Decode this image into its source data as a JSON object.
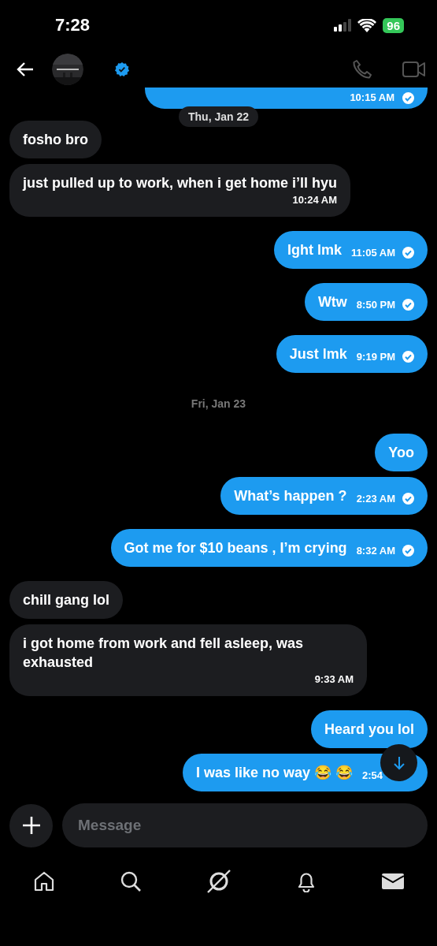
{
  "status_bar": {
    "time": "7:28",
    "battery": "96"
  },
  "header": {
    "verified": true
  },
  "messages": [
    {
      "kind": "date_pill",
      "text": "Thu, Jan 22"
    },
    {
      "kind": "received",
      "text": "fosho bro"
    },
    {
      "kind": "received",
      "text": "just pulled up to work, when i get home i’ll hyu",
      "time": "10:24 AM"
    },
    {
      "kind": "sent",
      "text": "Ight lmk",
      "time": "11:05 AM",
      "read": true
    },
    {
      "kind": "sent",
      "text": "Wtw",
      "time": "8:50 PM",
      "read": true
    },
    {
      "kind": "sent",
      "text": "Just lmk",
      "time": "9:19 PM",
      "read": true
    },
    {
      "kind": "date",
      "text": "Fri, Jan 23"
    },
    {
      "kind": "sent",
      "text": "Yoo"
    },
    {
      "kind": "sent",
      "text": "What’s happen ?",
      "time": "2:23 AM",
      "read": true
    },
    {
      "kind": "sent",
      "text": "Got me for $10 beans , I’m crying",
      "time": "8:32 AM",
      "read": true
    },
    {
      "kind": "received",
      "text": "chill gang lol"
    },
    {
      "kind": "received",
      "text": "i got home from work and fell asleep, was exhausted",
      "time": "9:33 AM"
    },
    {
      "kind": "sent",
      "text": "Heard you lol"
    },
    {
      "kind": "sent",
      "text": "I was like no way 😂 😂",
      "time": "2:54"
    }
  ],
  "top_partial_message": {
    "time": "10:15 AM",
    "read": true
  },
  "composer": {
    "placeholder": "Message"
  }
}
